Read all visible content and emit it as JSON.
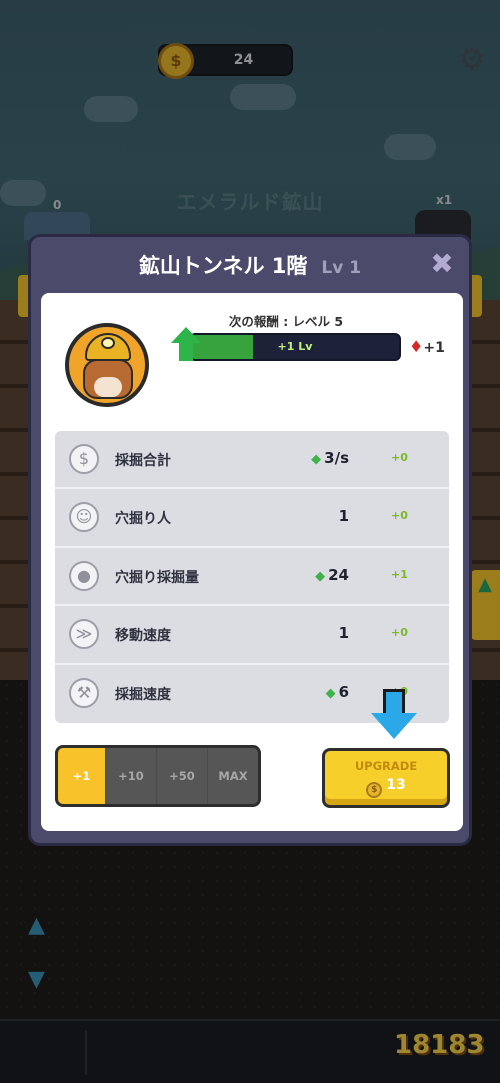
{
  "hud": {
    "currency_amount": "24",
    "shaft_left_count": "0",
    "shaft_right_label": "x1"
  },
  "background": {
    "mine_name": "エメラルド鉱山"
  },
  "modal": {
    "title": "鉱山トンネル 1階",
    "level": "Lv 1",
    "next_reward_text": "次の報酬 : レベル 5",
    "progress_label": "+1 Lv",
    "progress_fraction": 0.3,
    "gem_reward": "+1",
    "stats": [
      {
        "icon": "coin-icon",
        "label": "採掘合計",
        "value": "3/s",
        "has_gem": true,
        "delta": "+0"
      },
      {
        "icon": "miner-icon",
        "label": "穴掘り人",
        "value": "1",
        "has_gem": false,
        "delta": "+0"
      },
      {
        "icon": "ore-icon",
        "label": "穴掘り採掘量",
        "value": "24",
        "has_gem": true,
        "delta": "+1"
      },
      {
        "icon": "boot-icon",
        "label": "移動速度",
        "value": "1",
        "has_gem": false,
        "delta": "+0"
      },
      {
        "icon": "pickaxe-icon",
        "label": "採掘速度",
        "value": "6",
        "has_gem": true,
        "delta": "+0"
      }
    ],
    "multipliers": [
      "+1",
      "+10",
      "+50",
      "MAX"
    ],
    "selected_multiplier": "+1",
    "upgrade_label": "UPGRADE",
    "upgrade_cost": "13"
  },
  "watermark": "18183",
  "colors": {
    "accent_yellow": "#f7cf2a",
    "gem_green": "#3fb34a",
    "progress_green": "#37a33d",
    "modal_bg": "#4b4a6a",
    "hint_blue": "#2aa8e8"
  }
}
